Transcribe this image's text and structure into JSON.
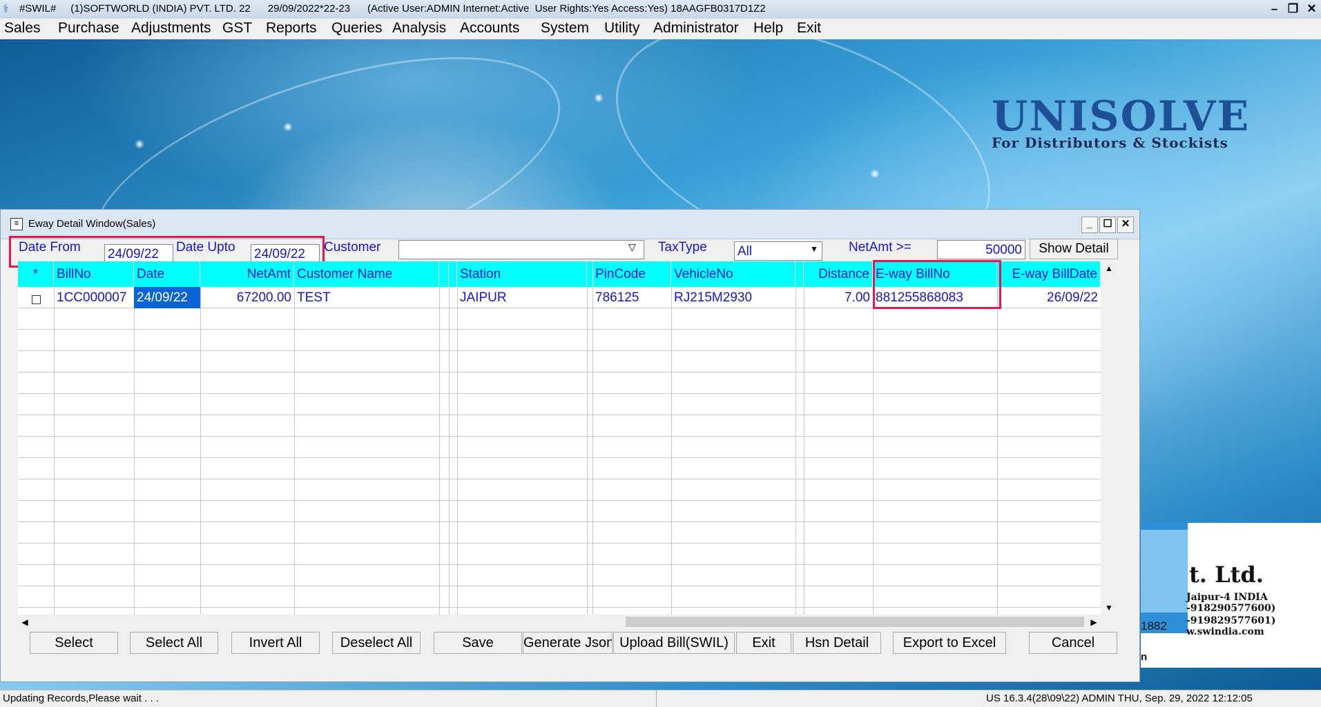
{
  "app": {
    "title": "#SWIL#     (1)SOFTWORLD (INDIA) PVT. LTD. 22      29/09/2022*22-23      (Active User:ADMIN Internet:Active  User Rights:Yes Access:Yes) 18AAGFB0317D1Z2"
  },
  "menu": [
    "Sales",
    "Purchase",
    "Adjustments",
    "GST",
    "Reports",
    "Queries",
    "Analysis",
    "Accounts",
    "System",
    "Utility",
    "Administrator",
    "Help",
    "Exit"
  ],
  "logo": {
    "name": "UNISOLVE",
    "tagline": "For Distributors & Stockists"
  },
  "company": {
    "ltd": "t. Ltd.",
    "address1": "Jaipur-4 INDIA",
    "address2": "-918290577600)",
    "address3": "-919829577601)",
    "address4": "w.swindia.com",
    "num": "1882",
    "n": "n"
  },
  "window": {
    "title": "Eway Detail Window(Sales)",
    "filters": {
      "date_from_label": "Date From",
      "date_from": "24/09/22",
      "date_upto_label": "Date Upto",
      "date_upto": "24/09/22",
      "customer_label": "Customer",
      "customer": "",
      "taxtype_label": "TaxType",
      "taxtype": "All",
      "netamt_label": "NetAmt >=",
      "netamt": "50000",
      "show_detail": "Show Detail"
    },
    "columns": [
      "*",
      "BillNo",
      "Date",
      "NetAmt",
      "Customer Name",
      "Station",
      "PinCode",
      "VehicleNo",
      "Distance",
      "E-way BillNo",
      "E-way BillDate"
    ],
    "rows": [
      {
        "billno": "1CC000007",
        "date": "24/09/22",
        "netamt": "67200.00",
        "customer": "TEST",
        "station": "JAIPUR",
        "pincode": "786125",
        "vehicle": "RJ215M2930",
        "distance": "7.00",
        "ewaybill": "881255868083",
        "ewaydate": "26/09/22"
      }
    ],
    "buttons": {
      "select": "Select",
      "select_all": "Select All",
      "invert_all": "Invert All",
      "deselect_all": "Deselect All",
      "save": "Save",
      "generate_json": "Generate Json",
      "upload_bill": "Upload Bill(SWIL)",
      "exit": "Exit",
      "hsn_detail": "Hsn Detail",
      "export_excel": "Export to Excel",
      "cancel": "Cancel"
    }
  },
  "status": {
    "left": "Updating Records,Please wait . . .",
    "right": "US 16.3.4(28\\09\\22) ADMIN  THU, Sep. 29, 2022  12:12:05"
  },
  "colors": {
    "accent_red": "#e8164f",
    "grid_header": "#00ffff",
    "text_blue": "#1515d6",
    "selected": "#0a64d8"
  }
}
